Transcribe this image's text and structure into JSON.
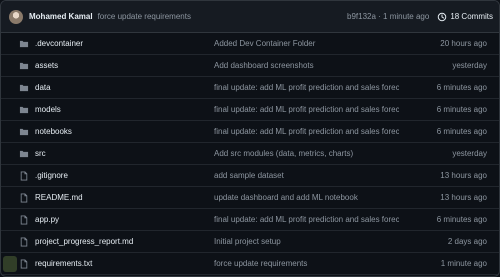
{
  "commit": {
    "author": "Mohamed Kamal",
    "message": "force update requirements",
    "meta": "b9f132a · 1 minute ago",
    "commits_label": "18 Commits"
  },
  "colors": {
    "folder": "#7d8590",
    "file": "#7d8590",
    "muted": "#8d96a0",
    "text": "#e6edf3",
    "background": "#0d1117"
  },
  "files": [
    {
      "type": "folder",
      "icon": "folder-icon",
      "name": ".devcontainer",
      "message": "Added Dev Container Folder",
      "time": "20 hours ago"
    },
    {
      "type": "folder",
      "icon": "folder-icon",
      "name": "assets",
      "message": "Add dashboard screenshots",
      "time": "yesterday"
    },
    {
      "type": "folder",
      "icon": "folder-icon",
      "name": "data",
      "message": "final update: add ML profit prediction and sales forecasting",
      "time": "6 minutes ago"
    },
    {
      "type": "folder",
      "icon": "folder-icon",
      "name": "models",
      "message": "final update: add ML profit prediction and sales forecasting",
      "time": "6 minutes ago"
    },
    {
      "type": "folder",
      "icon": "folder-icon",
      "name": "notebooks",
      "message": "final update: add ML profit prediction and sales forecasting",
      "time": "6 minutes ago"
    },
    {
      "type": "folder",
      "icon": "folder-icon",
      "name": "src",
      "message": "Add src modules (data, metrics, charts)",
      "time": "yesterday"
    },
    {
      "type": "file",
      "icon": "file-icon",
      "name": ".gitignore",
      "message": "add sample dataset",
      "time": "13 hours ago"
    },
    {
      "type": "file",
      "icon": "file-icon",
      "name": "README.md",
      "message": "update dashboard and add ML notebook",
      "time": "13 hours ago"
    },
    {
      "type": "file",
      "icon": "file-icon",
      "name": "app.py",
      "message": "final update: add ML profit prediction and sales forecasting",
      "time": "6 minutes ago"
    },
    {
      "type": "file",
      "icon": "file-icon",
      "name": "project_progress_report.md",
      "message": "Initial project setup",
      "time": "2 days ago"
    },
    {
      "type": "file",
      "icon": "file-icon",
      "name": "requirements.txt",
      "message": "force update requirements",
      "time": "1 minute ago"
    }
  ]
}
